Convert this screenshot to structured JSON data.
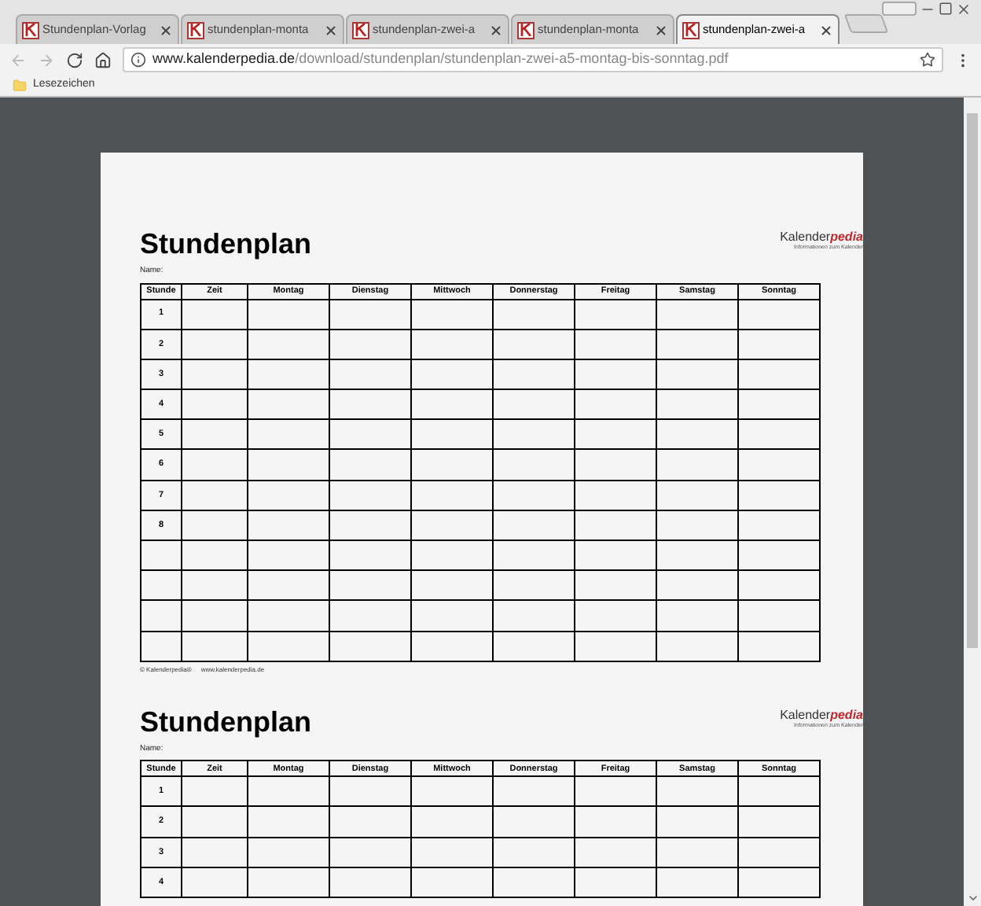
{
  "browser_tabs": [
    {
      "title": "Stundenplan-Vorlag",
      "selected": false
    },
    {
      "title": "stundenplan-monta",
      "selected": false
    },
    {
      "title": "stundenplan-zwei-a",
      "selected": false
    },
    {
      "title": "stundenplan-monta",
      "selected": false
    },
    {
      "title": "stundenplan-zwei-a",
      "selected": true
    }
  ],
  "address_bar": {
    "host": "www.kalenderpedia.de",
    "path": "/download/stundenplan/stundenplan-zwei-a5-montag-bis-sonntag.pdf"
  },
  "bookmarks_bar": {
    "folder": "Lesezeichen"
  },
  "pdf_pages": [
    {
      "title": "Stundenplan",
      "logo": {
        "name_part": "Kalender",
        "accent_part": "pedia",
        "tagline": "Informationen zum Kalender"
      },
      "name_label": "Name:",
      "columns": [
        "Stunde",
        "Zeit",
        "Montag",
        "Dienstag",
        "Mittwoch",
        "Donnerstag",
        "Freitag",
        "Samstag",
        "Sonntag"
      ],
      "rows": [
        {
          "kind": "numbered",
          "label": "1"
        },
        {
          "kind": "numbered",
          "label": "2"
        },
        {
          "kind": "numbered",
          "label": "3"
        },
        {
          "kind": "numbered",
          "label": "4"
        },
        {
          "kind": "numbered",
          "label": "5"
        },
        {
          "kind": "numbered",
          "label": "6"
        },
        {
          "kind": "numbered",
          "label": "7"
        },
        {
          "kind": "numbered",
          "label": "8"
        },
        {
          "kind": "blank"
        },
        {
          "kind": "blank"
        },
        {
          "kind": "blank"
        },
        {
          "kind": "blank"
        }
      ],
      "footer": {
        "copyright": "© Kalenderpedia®",
        "website": "www.kalenderpedia.de"
      }
    },
    {
      "title": "Stundenplan",
      "logo": {
        "name_part": "Kalender",
        "accent_part": "pedia",
        "tagline": "Informationen zum Kalender"
      },
      "name_label": "Name:",
      "columns": [
        "Stunde",
        "Zeit",
        "Montag",
        "Dienstag",
        "Mittwoch",
        "Donnerstag",
        "Freitag",
        "Samstag",
        "Sonntag"
      ],
      "rows": [
        {
          "kind": "numbered",
          "label": "1"
        },
        {
          "kind": "numbered",
          "label": "2"
        },
        {
          "kind": "numbered",
          "label": "3"
        },
        {
          "kind": "numbered",
          "label": "4"
        }
      ]
    }
  ]
}
